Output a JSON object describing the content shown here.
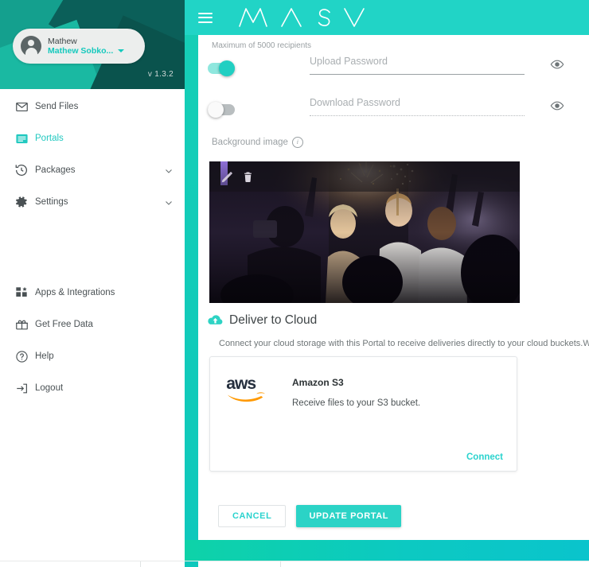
{
  "app": {
    "brand": "MASV",
    "version_label": "v 1.3.2"
  },
  "topbar": {
    "menu_icon": "hamburger-icon",
    "logo_text": "MASV"
  },
  "user": {
    "name": "Mathew",
    "account": "Mathew Sobko...",
    "avatar_icon": "user-avatar-icon",
    "caret_icon": "chevron-down-icon"
  },
  "sidebar": {
    "primary_items": [
      {
        "label": "Send Files",
        "icon": "envelope-icon",
        "active": false,
        "expandable": false
      },
      {
        "label": "Portals",
        "icon": "portal-window-icon",
        "active": true,
        "expandable": false
      },
      {
        "label": "Packages",
        "icon": "history-clock-icon",
        "active": false,
        "expandable": true
      },
      {
        "label": "Settings",
        "icon": "gear-icon",
        "active": false,
        "expandable": true
      }
    ],
    "secondary_items": [
      {
        "label": "Apps & Integrations",
        "icon": "grid-apps-icon",
        "active": false,
        "expandable": false
      },
      {
        "label": "Get Free Data",
        "icon": "gift-box-icon",
        "active": false,
        "expandable": false
      },
      {
        "label": "Help",
        "icon": "question-circle-icon",
        "active": false,
        "expandable": false
      },
      {
        "label": "Logout",
        "icon": "logout-arrow-icon",
        "active": false,
        "expandable": false
      }
    ]
  },
  "form": {
    "recipients_hint": "Maximum of 5000 recipients",
    "upload_password": {
      "label": "Upload Password",
      "value": "",
      "enabled": true,
      "reveal_icon": "eye-icon"
    },
    "download_password": {
      "label": "Download Password",
      "value": "",
      "enabled": false,
      "reveal_icon": "eye-icon"
    },
    "background_image": {
      "label": "Background image",
      "info_icon": "info-icon",
      "edit_icon": "pencil-icon",
      "delete_icon": "trash-icon",
      "alt": "Nightclub party crowd with sparklers"
    }
  },
  "cloud": {
    "icon": "cloud-upload-icon",
    "title": "Deliver to Cloud",
    "description": "Connect your cloud storage with this Portal to receive deliveries directly to your cloud buckets.We will ser",
    "providers": [
      {
        "logo": "aws-logo",
        "name": "Amazon S3",
        "description": "Receive files to your S3 bucket.",
        "action_label": "Connect"
      }
    ]
  },
  "actions": {
    "cancel_label": "CANCEL",
    "submit_label": "UPDATE PORTAL"
  },
  "colors": {
    "accent_teal": "#21d4c6",
    "accent_link": "#2bd3ce",
    "sidebar_hero_dark": "#0c7068",
    "text_primary": "#3f4547",
    "text_muted": "#9aa0a3"
  }
}
